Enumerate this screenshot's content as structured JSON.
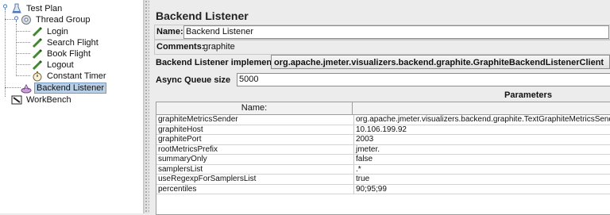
{
  "tree": {
    "items": [
      {
        "label": "Test Plan",
        "icon": "flask-icon"
      },
      {
        "label": "Thread Group",
        "icon": "gear-icon"
      },
      {
        "label": "Login",
        "icon": "pipette-icon"
      },
      {
        "label": "Search Flight",
        "icon": "pipette-icon"
      },
      {
        "label": "Book Flight",
        "icon": "pipette-icon"
      },
      {
        "label": "Logout",
        "icon": "pipette-icon"
      },
      {
        "label": "Constant Timer",
        "icon": "stopwatch-icon"
      },
      {
        "label": "Backend Listener",
        "icon": "listener-icon"
      },
      {
        "label": "WorkBench",
        "icon": "workbench-icon"
      }
    ]
  },
  "panel": {
    "title": "Backend Listener",
    "name_label": "Name:",
    "name_value": "Backend Listener",
    "comments_label": "Comments:",
    "comments_value": "graphite",
    "impl_label": "Backend Listener implementation",
    "impl_value": "org.apache.jmeter.visualizers.backend.graphite.GraphiteBackendListenerClient",
    "queue_label": "Async Queue size",
    "queue_value": "5000",
    "params_label": "Parameters"
  },
  "table": {
    "headers": [
      "Name:",
      ""
    ],
    "rows": [
      [
        "graphiteMetricsSender",
        "org.apache.jmeter.visualizers.backend.graphite.TextGraphiteMetricsSender"
      ],
      [
        "graphiteHost",
        "10.106.199.92"
      ],
      [
        "graphitePort",
        "2003"
      ],
      [
        "rootMetricsPrefix",
        "jmeter."
      ],
      [
        "summaryOnly",
        "false"
      ],
      [
        "samplersList",
        ".*"
      ],
      [
        "useRegexpForSamplersList",
        "true"
      ],
      [
        "percentiles",
        "90;95;99"
      ]
    ]
  },
  "colors": {
    "selection": "#b8cfe5",
    "panel_bg": "#ececec"
  }
}
